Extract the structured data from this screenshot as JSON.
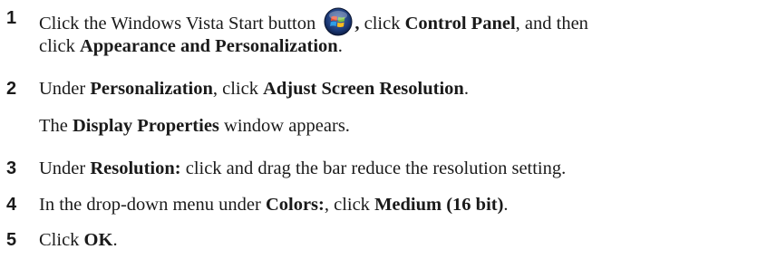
{
  "steps": [
    {
      "number": "1",
      "line1_prefix": "Click the Windows Vista Start button",
      "line1_comma": ",",
      "line1_mid": " click ",
      "control_panel": "Control Panel",
      "line1_suffix": ", and then",
      "line2_prefix": "click ",
      "appearance": "Appearance and Personalization",
      "line2_suffix": ".",
      "start_button_icon": "windows-vista-start-orb-icon"
    },
    {
      "number": "2",
      "prefix": "Under ",
      "personalization": "Personalization",
      "mid": ", click ",
      "adjust": "Adjust Screen Resolution",
      "suffix": ".",
      "note_prefix": "The ",
      "display_properties": "Display Properties",
      "note_suffix": " window appears."
    },
    {
      "number": "3",
      "prefix": "Under ",
      "resolution": "Resolution:",
      "suffix": " click and drag the bar reduce the resolution setting."
    },
    {
      "number": "4",
      "prefix": "In the drop-down menu under ",
      "colors": "Colors:",
      "mid": ", click ",
      "medium": "Medium (16 bit)",
      "suffix": "."
    },
    {
      "number": "5",
      "prefix": "Click ",
      "ok": "OK",
      "suffix": "."
    }
  ]
}
